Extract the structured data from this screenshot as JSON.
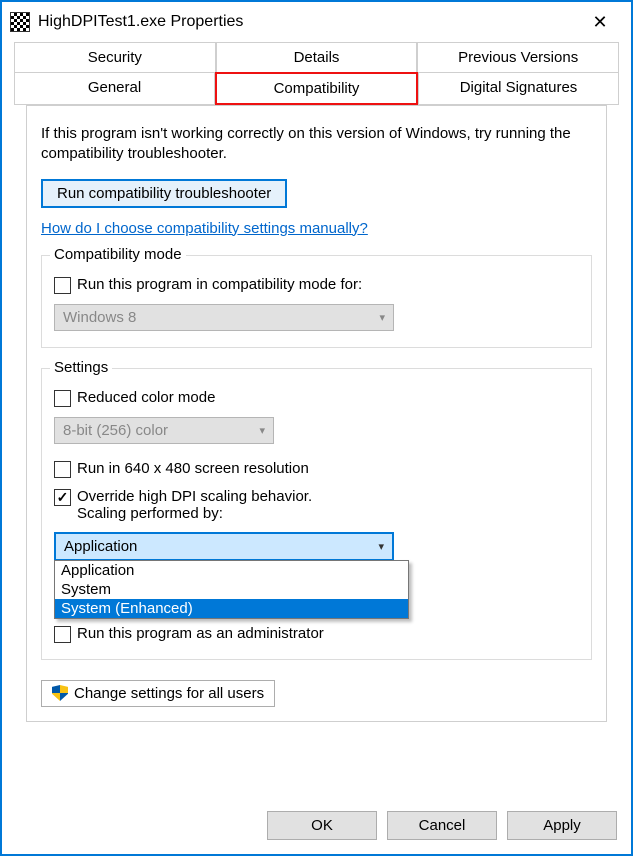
{
  "titlebar": {
    "title": "HighDPITest1.exe Properties"
  },
  "tabs": {
    "row1": [
      "Security",
      "Details",
      "Previous Versions"
    ],
    "row2": [
      "General",
      "Compatibility",
      "Digital Signatures"
    ],
    "active": "Compatibility"
  },
  "intro": "If this program isn't working correctly on this version of Windows, try running the compatibility troubleshooter.",
  "troubleshoot_btn": "Run compatibility troubleshooter",
  "help_link": "How do I choose compatibility settings manually?",
  "compatibility_mode": {
    "legend": "Compatibility mode",
    "checkbox_label": "Run this program in compatibility mode for:",
    "selected": "Windows 8"
  },
  "settings": {
    "legend": "Settings",
    "reduced_color_label": "Reduced color mode",
    "color_selected": "8-bit (256) color",
    "run640_label": "Run in 640 x 480 screen resolution",
    "override_dpi_line1": "Override high DPI scaling behavior.",
    "override_dpi_line2": "Scaling performed by:",
    "dpi_selected": "Application",
    "dpi_options": [
      "Application",
      "System",
      "System (Enhanced)"
    ],
    "dpi_highlighted": "System (Enhanced)",
    "obscured_admin": "Run this program as an administrator"
  },
  "change_all_users": "Change settings for all users",
  "buttons": {
    "ok": "OK",
    "cancel": "Cancel",
    "apply": "Apply"
  }
}
